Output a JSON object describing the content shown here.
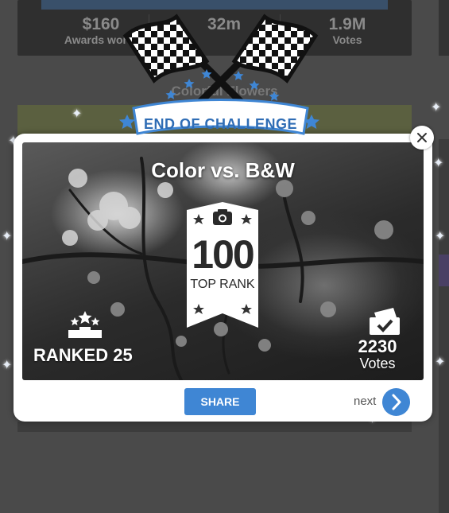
{
  "background": {
    "stats": [
      {
        "value": "$160",
        "label": "Awards worth"
      },
      {
        "value": "32m",
        "label": ""
      },
      {
        "value": "1.9M",
        "label": "Votes"
      }
    ],
    "challenge_title": "Colorful Flowers"
  },
  "header": {
    "banner_text": "END OF CHALLENGE"
  },
  "modal": {
    "title": "Color vs. B&W",
    "badge": {
      "number": "100",
      "label": "TOP RANK"
    },
    "ranked_text": "RANKED 25",
    "votes": {
      "count": "2230",
      "label": "Votes"
    },
    "share_label": "SHARE",
    "next_label": "next",
    "close_icon": "close-icon"
  },
  "colors": {
    "accent": "#3f86d4",
    "banner_text": "#2f6db5",
    "star": "#3f86d4"
  }
}
